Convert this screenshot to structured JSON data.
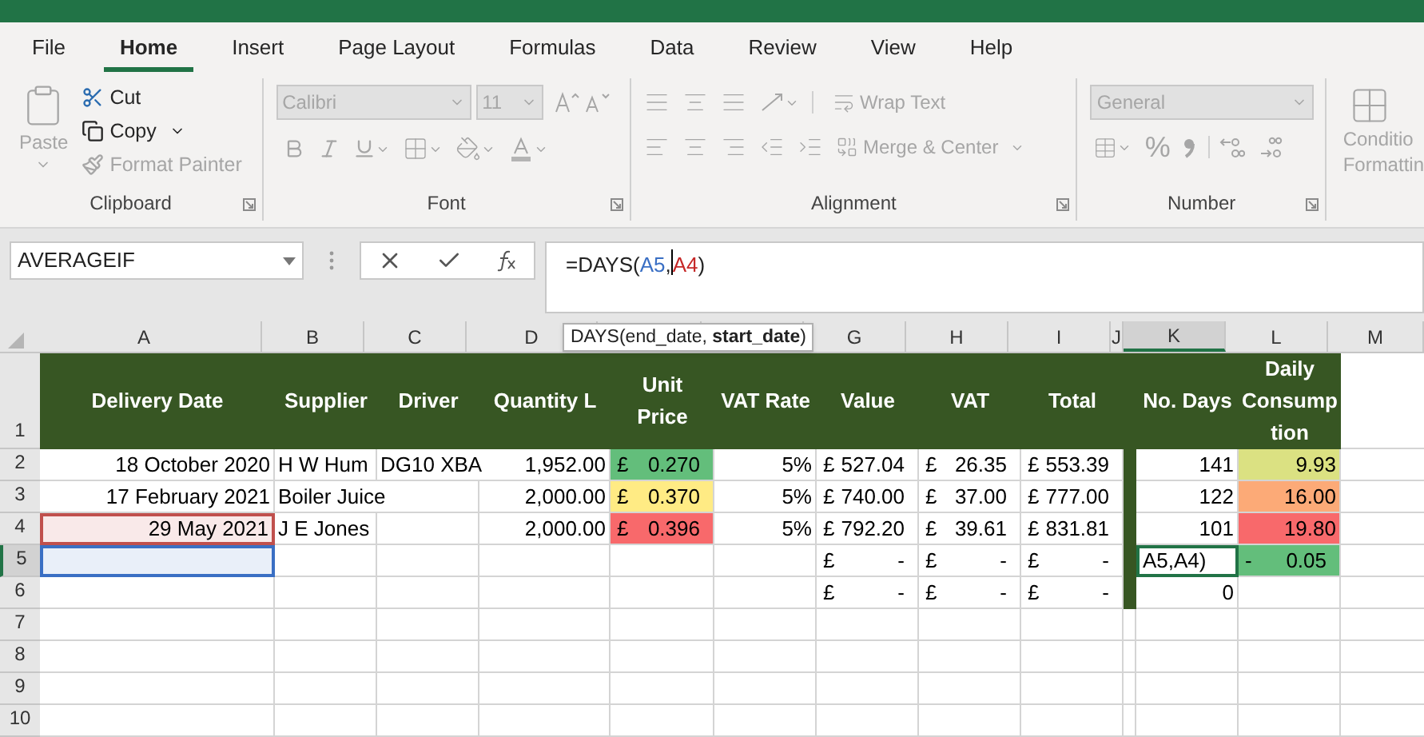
{
  "tabs": [
    {
      "label": "File",
      "selected": false
    },
    {
      "label": "Home",
      "selected": true
    },
    {
      "label": "Insert",
      "selected": false
    },
    {
      "label": "Page Layout",
      "selected": false
    },
    {
      "label": "Formulas",
      "selected": false
    },
    {
      "label": "Data",
      "selected": false
    },
    {
      "label": "Review",
      "selected": false
    },
    {
      "label": "View",
      "selected": false
    },
    {
      "label": "Help",
      "selected": false
    }
  ],
  "ribbon": {
    "clipboard": {
      "label": "Clipboard",
      "paste": {
        "label": "Paste",
        "disabled": true
      },
      "cut": {
        "label": "Cut",
        "disabled": false
      },
      "copy": {
        "label": "Copy",
        "disabled": false
      },
      "format_painter": {
        "label": "Format Painter",
        "disabled": true
      }
    },
    "font": {
      "label": "Font",
      "font_name": "Calibri",
      "font_size": "11"
    },
    "alignment": {
      "label": "Alignment",
      "wrap_text": "Wrap Text",
      "merge_center": "Merge & Center"
    },
    "number": {
      "label": "Number",
      "format": "General",
      "percent": "%"
    },
    "conditional": {
      "lines": [
        "Conditio",
        "Formattin"
      ]
    }
  },
  "formula_bar": {
    "name_box": "AVERAGEIF",
    "parts": [
      {
        "text": "=DAYS("
      },
      {
        "text": "A5",
        "color": "#3a6fc4"
      },
      {
        "text": ","
      },
      {
        "text": "A4",
        "color": "#c62828",
        "cursor": true
      },
      {
        "text": ")"
      }
    ],
    "tooltip": "DAYS(end_date, **start_date**)"
  },
  "columns": [
    {
      "label": "A",
      "selected": false
    },
    {
      "label": "B",
      "selected": false
    },
    {
      "label": "C",
      "selected": false
    },
    {
      "label": "D",
      "selected": false
    },
    {
      "selected": false
    },
    {
      "selected": false
    },
    {
      "label": "G",
      "selected": false
    },
    {
      "label": "H",
      "selected": false
    },
    {
      "label": "I",
      "selected": false
    },
    {
      "label": "J",
      "selected": false
    },
    {
      "label": "K",
      "selected": true
    },
    {
      "label": "L",
      "selected": false
    },
    {
      "label": "M",
      "selected": false
    }
  ],
  "rows": [
    {
      "label": "1",
      "selected": false,
      "cells": [
        {
          "kind": "header",
          "lines": [
            "Delivery Date"
          ]
        },
        {
          "kind": "header",
          "lines": [
            "Supplier"
          ]
        },
        {
          "kind": "header",
          "lines": [
            "Driver"
          ]
        },
        {
          "kind": "header",
          "lines": [
            "Quantity L"
          ]
        },
        {
          "kind": "header",
          "lines": [
            "Unit",
            "Price"
          ]
        },
        {
          "kind": "header",
          "lines": [
            "VAT Rate"
          ]
        },
        {
          "kind": "header",
          "lines": [
            "Value"
          ]
        },
        {
          "kind": "header",
          "lines": [
            "VAT"
          ]
        },
        {
          "kind": "header",
          "lines": [
            "Total"
          ]
        },
        {
          "kind": "header"
        },
        {
          "kind": "header",
          "lines": [
            "No. Days"
          ]
        },
        {
          "kind": "header",
          "lines": [
            "Daily",
            "Consump",
            "tion"
          ]
        },
        {}
      ]
    },
    {
      "label": "2",
      "selected": false,
      "cells": [
        {
          "text": "18 October 2020"
        },
        {
          "text": "H W Hum",
          "kind": "text"
        },
        {
          "text": "DG10 XBA",
          "kind": "text"
        },
        {
          "text": "1,952.00"
        },
        {
          "prefix": "£",
          "text": "0.270",
          "color": "#63be7b"
        },
        {
          "text": "5%"
        },
        {
          "prefix": "£",
          "text": "527.04"
        },
        {
          "prefix": "£",
          "text": "26.35"
        },
        {
          "prefix": "£",
          "text": "553.39"
        },
        {
          "kind": "band"
        },
        {
          "text": "141"
        },
        {
          "text": "9.93",
          "color": "#dbe182"
        },
        {}
      ]
    },
    {
      "label": "3",
      "selected": false,
      "cells": [
        {
          "text": "17 February 2021"
        },
        {
          "text": "Boiler Juice",
          "kind": "text"
        },
        {},
        {
          "text": "2,000.00"
        },
        {
          "prefix": "£",
          "text": "0.370",
          "color": "#ffeb84"
        },
        {
          "text": "5%"
        },
        {
          "prefix": "£",
          "text": "740.00"
        },
        {
          "prefix": "£",
          "text": "37.00"
        },
        {
          "prefix": "£",
          "text": "777.00"
        },
        {
          "kind": "band"
        },
        {
          "text": "122"
        },
        {
          "text": "16.00",
          "color": "#fcaa77"
        },
        {}
      ]
    },
    {
      "label": "4",
      "selected": false,
      "cells": [
        {
          "text": "29 May 2021",
          "kind": "ref-red"
        },
        {
          "text": "J E Jones",
          "kind": "text"
        },
        {},
        {
          "text": "2,000.00"
        },
        {
          "prefix": "£",
          "text": "0.396",
          "color": "#f8696b"
        },
        {
          "text": "5%"
        },
        {
          "prefix": "£",
          "text": "792.20"
        },
        {
          "prefix": "£",
          "text": "39.61"
        },
        {
          "prefix": "£",
          "text": "831.81"
        },
        {
          "kind": "band"
        },
        {
          "text": "101"
        },
        {
          "text": "19.80",
          "color": "#f8696b"
        },
        {}
      ]
    },
    {
      "label": "5",
      "selected": true,
      "cells": [
        {
          "kind": "ref-blue"
        },
        {},
        {},
        {},
        {},
        {},
        {
          "prefix": "£",
          "text": "-"
        },
        {
          "prefix": "£",
          "text": "-"
        },
        {
          "prefix": "£",
          "text": "-"
        },
        {
          "kind": "band"
        },
        {
          "text": "A5,A4)",
          "kind": "editing"
        },
        {
          "prefix": "-",
          "text": "0.05",
          "color": "#63be7b"
        },
        {}
      ]
    },
    {
      "label": "6",
      "selected": false,
      "cells": [
        {},
        {},
        {},
        {},
        {},
        {},
        {
          "prefix": "£",
          "text": "-"
        },
        {
          "prefix": "£",
          "text": "-"
        },
        {
          "prefix": "£",
          "text": "-"
        },
        {
          "kind": "band"
        },
        {
          "text": "0"
        },
        {},
        {}
      ]
    },
    {
      "label": "7",
      "selected": false,
      "cells": [
        {},
        {},
        {},
        {},
        {},
        {},
        {},
        {},
        {},
        {},
        {},
        {},
        {}
      ]
    },
    {
      "label": "8",
      "selected": false,
      "cells": [
        {},
        {},
        {},
        {},
        {},
        {},
        {},
        {},
        {},
        {},
        {},
        {},
        {}
      ]
    },
    {
      "label": "9",
      "selected": false,
      "cells": [
        {},
        {},
        {},
        {},
        {},
        {},
        {},
        {},
        {},
        {},
        {},
        {},
        {}
      ]
    },
    {
      "label": "10",
      "selected": false,
      "cells": [
        {},
        {},
        {},
        {},
        {},
        {},
        {},
        {},
        {},
        {},
        {},
        {},
        {}
      ]
    }
  ]
}
